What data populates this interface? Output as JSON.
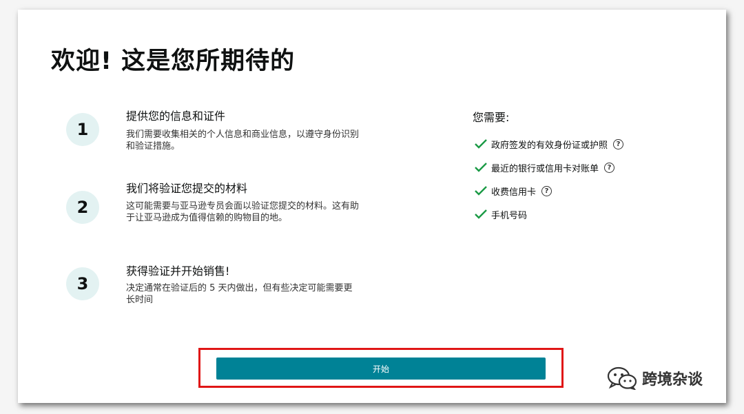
{
  "page": {
    "title": "欢迎! 这是您所期待的"
  },
  "steps": [
    {
      "number": "1",
      "title": "提供您的信息和证件",
      "description": "我们需要收集相关的个人信息和商业信息，以遵守身份识别和验证措施。"
    },
    {
      "number": "2",
      "title": "我们将验证您提交的材料",
      "description": "这可能需要与亚马逊专员会面以验证您提交的材料。这有助于让亚马逊成为值得信赖的购物目的地。"
    },
    {
      "number": "3",
      "title": "获得验证并开始销售!",
      "description": "决定通常在验证后的 5 天内做出，但有些决定可能需要更长时间"
    }
  ],
  "requirements": {
    "heading": "您需要:",
    "items": [
      {
        "label": "政府签发的有效身份证或护照",
        "has_help": true
      },
      {
        "label": "最近的银行或信用卡对账单",
        "has_help": true
      },
      {
        "label": "收费信用卡",
        "has_help": true
      },
      {
        "label": "手机号码",
        "has_help": false
      }
    ],
    "check_icon": "check-icon",
    "help_icon_glyph": "?"
  },
  "actions": {
    "start_label": "开始"
  },
  "watermark": {
    "text": "跨境杂谈",
    "icon": "wechat-icon"
  },
  "colors": {
    "primary_button": "#008296",
    "check": "#1a9a45",
    "highlight_border": "#e01616",
    "step_circle_bg": "#e3f2f2"
  }
}
